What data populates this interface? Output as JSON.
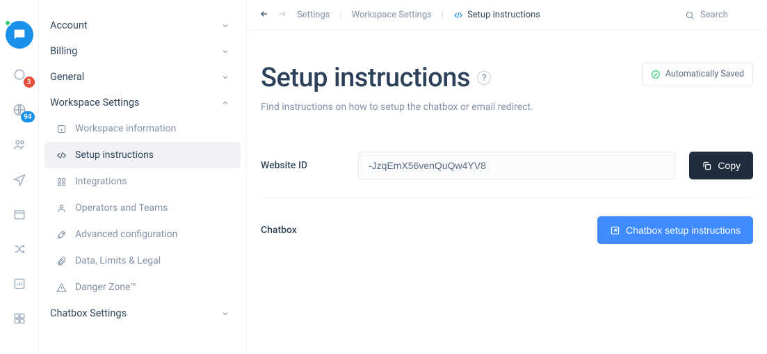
{
  "rail": {
    "badges": {
      "inbox": "3",
      "globe": "94"
    }
  },
  "sidebar": {
    "sections": {
      "account": "Account",
      "billing": "Billing",
      "general": "General",
      "workspace": "Workspace Settings",
      "chatbox": "Chatbox Settings"
    },
    "workspace_items": {
      "info": "Workspace information",
      "setup": "Setup instructions",
      "integrations": "Integrations",
      "operators": "Operators and Teams",
      "advanced": "Advanced configuration",
      "data": "Data, Limits & Legal",
      "danger": "Danger Zone™"
    }
  },
  "breadcrumb": {
    "settings": "Settings",
    "workspace": "Workspace Settings",
    "setup": "Setup instructions"
  },
  "search": {
    "placeholder": "Search"
  },
  "page": {
    "title": "Setup instructions",
    "subtitle": "Find instructions on how to setup the chatbox or email redirect.",
    "saved": "Automatically Saved"
  },
  "rows": {
    "website_id": {
      "label": "Website ID",
      "value": "-JzqEmX56venQuQw4YV8",
      "copy": "Copy"
    },
    "chatbox": {
      "label": "Chatbox",
      "button": "Chatbox setup instructions"
    }
  }
}
